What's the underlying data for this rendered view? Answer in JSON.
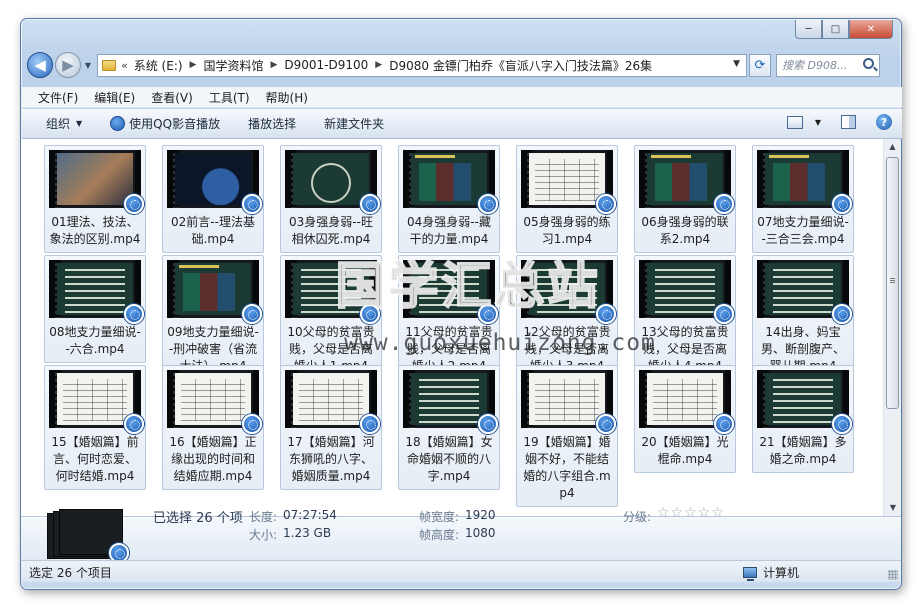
{
  "window": {
    "caption_buttons": [
      "─",
      "□",
      "✕"
    ]
  },
  "nav": {
    "back_icon": "◀",
    "forward_icon": "▶",
    "breadcrumb_lead": "«",
    "breadcrumbs": [
      "系统 (E:)",
      "国学资料馆",
      "D9001-D9100",
      "D9080 金镖门柏乔《盲派八字入门技法篇》26集"
    ],
    "refresh_icon": "⟳",
    "search_placeholder": "搜索 D908..."
  },
  "menu": [
    "文件(F)",
    "编辑(E)",
    "查看(V)",
    "工具(T)",
    "帮助(H)"
  ],
  "toolbar": {
    "organize": "组织",
    "qq_player": "使用QQ影音播放",
    "play_selection": "播放选择",
    "new_folder": "新建文件夹",
    "help": "?"
  },
  "files": [
    {
      "label": "01理法、技法、象法的区别.mp4",
      "thumb": "photo"
    },
    {
      "label": "02前言--理法基础.mp4",
      "thumb": "space"
    },
    {
      "label": "03身强身弱--旺相休囚死.mp4",
      "thumb": "star"
    },
    {
      "label": "04身强身弱--藏干的力量.mp4",
      "thumb": "board"
    },
    {
      "label": "05身强身弱的练习1.mp4",
      "thumb": "table"
    },
    {
      "label": "06身强身弱的联系2.mp4",
      "thumb": "board"
    },
    {
      "label": "07地支力量细说--三合三会.mp4",
      "thumb": "board"
    },
    {
      "label": "08地支力量细说--六合.mp4",
      "thumb": "list"
    },
    {
      "label": "09地支力量细说--刑冲破害（省流大法）.mp4",
      "thumb": "board"
    },
    {
      "label": "10父母的贫富贵贱，父母是否离婚少人1.mp4",
      "thumb": "list"
    },
    {
      "label": "11父母的贫富贵贱，父母是否离婚少人2.mp4",
      "thumb": "list"
    },
    {
      "label": "12父母的贫富贵贱，父母是否离婚少人3.mp4",
      "thumb": "list"
    },
    {
      "label": "13父母的贫富贵贱，父母是否离婚少人4.mp4",
      "thumb": "list"
    },
    {
      "label": "14出身、妈宝男、断剖腹产、婴儿期.mp4",
      "thumb": "list"
    },
    {
      "label": "15【婚姻篇】前言、何时恋爱、何时结婚.mp4",
      "thumb": "table"
    },
    {
      "label": "16【婚姻篇】正缘出现的时间和结婚应期.mp4",
      "thumb": "table"
    },
    {
      "label": "17【婚姻篇】河东狮吼的八字、婚姻质量.mp4",
      "thumb": "table"
    },
    {
      "label": "18【婚姻篇】女命婚姻不顺的八字.mp4",
      "thumb": "list"
    },
    {
      "label": "19【婚姻篇】婚姻不好，不能结婚的八字组合.mp4",
      "thumb": "table"
    },
    {
      "label": "20【婚姻篇】光棍命.mp4",
      "thumb": "table"
    },
    {
      "label": "21【婚姻篇】多婚之命.mp4",
      "thumb": "list"
    }
  ],
  "watermark": {
    "cn": "国学汇总站",
    "url": "www.guoxuehuizong.com"
  },
  "details": {
    "selected": "已选择 26 个项",
    "duration_label": "长度:",
    "duration_value": "07:27:54",
    "size_label": "大小:",
    "size_value": "1.23 GB",
    "width_label": "帧宽度:",
    "width_value": "1920",
    "height_label": "帧高度:",
    "height_value": "1080",
    "rating_label": "分级:",
    "rating_stars": "☆☆☆☆☆"
  },
  "status": {
    "left": "选定 26 个项目",
    "right": "计算机"
  }
}
